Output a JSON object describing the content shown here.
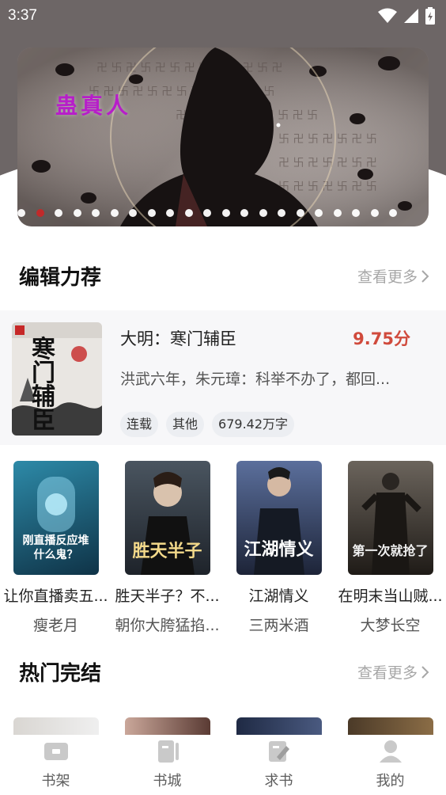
{
  "status_bar": {
    "time": "3:37"
  },
  "banner": {
    "title": "蛊真人",
    "slide_count": 21,
    "active_index": 1
  },
  "editor_section": {
    "title": "编辑力荐",
    "more_label": "查看更多"
  },
  "featured_book": {
    "title": "大明：寒门辅臣",
    "score": "9.75分",
    "description": "洪武六年，朱元璋：科举不办了，都回...",
    "tags": [
      "连载",
      "其他",
      "679.42万字"
    ],
    "cover_text": "寒门辅臣"
  },
  "books": [
    {
      "title": "让你直播卖五...",
      "author": "瘦老月",
      "cover_text": "刚直播反应堆 什么鬼？",
      "cover_color": "#1f5f7a"
    },
    {
      "title": "胜天半子？不...",
      "author": "朝你大胯猛掐...",
      "cover_text": "胜天半子",
      "cover_color": "#2b3340"
    },
    {
      "title": "江湖情义",
      "author": "三两米酒",
      "cover_text": "江湖情义",
      "cover_color": "#2e3e63"
    },
    {
      "title": "在明末当山贼...",
      "author": "大梦长空",
      "cover_text": "第一次就抢了",
      "cover_color": "#3a342d"
    }
  ],
  "hot_section": {
    "title": "热门完结",
    "more_label": "查看更多"
  },
  "bottom_nav": [
    {
      "label": "书架",
      "icon": "bookshelf-icon"
    },
    {
      "label": "书城",
      "icon": "bookstore-icon"
    },
    {
      "label": "求书",
      "icon": "request-book-icon"
    },
    {
      "label": "我的",
      "icon": "profile-icon"
    }
  ],
  "colors": {
    "accent_red": "#d04a3c",
    "header_bg": "#6d6666"
  }
}
